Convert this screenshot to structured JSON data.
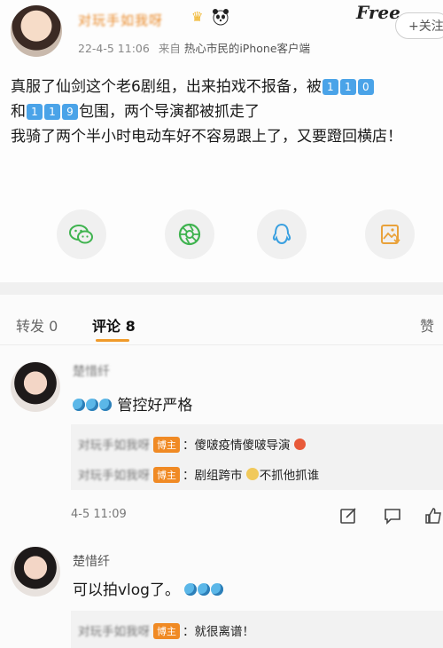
{
  "post": {
    "username": "对玩手如我呀",
    "meta_time": "22-4-5 11:06",
    "meta_from_prefix": "来自",
    "meta_from": "热心市民的iPhone客户端",
    "follow_label": "+关注",
    "watermark": "Free",
    "line1": "真服了仙剑这个老6剧组，出来拍戏不报备，被",
    "num_a": [
      "1",
      "1",
      "0"
    ],
    "line2_prefix": "和",
    "num_b": [
      "1",
      "1",
      "9"
    ],
    "line2_suffix": "包围，两个导演都被抓走了",
    "line3": "我骑了两个半小时电动车好不容易跟上了，又要蹬回横店！"
  },
  "share_icons": [
    "wechat-icon",
    "moments-icon",
    "qq-icon",
    "save-image-icon"
  ],
  "tabs": {
    "repost": "转发 0",
    "comment": "评论 8",
    "like": "赞"
  },
  "comments": [
    {
      "name": "楚惜纤",
      "text": "管控好严格",
      "replies": [
        {
          "user": "对玩手如我呀",
          "badge": "博主",
          "text": "：傻啵疫情傻啵导演"
        },
        {
          "user": "对玩手如我呀",
          "badge": "博主",
          "text": "：剧组跨市",
          "text2": "不抓他抓谁"
        }
      ],
      "time": "4-5 11:09"
    },
    {
      "name": "楚惜纤",
      "text_a": "可以拍",
      "text_b": "vlog了。",
      "replies": [
        {
          "user": "对玩手如我呀",
          "badge": "博主",
          "text": "：就很离谱！"
        }
      ]
    }
  ],
  "colors": {
    "accent": "#f09a2a",
    "badge": "#f08a24",
    "link_blue": "#4aa3e8",
    "wechat": "#3fb34f"
  }
}
